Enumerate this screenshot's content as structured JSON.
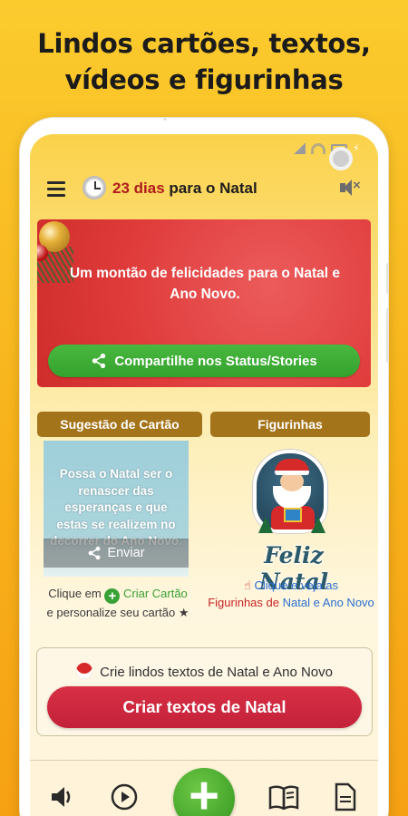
{
  "promo": {
    "headline_line1": "Lindos cartões, textos,",
    "headline_line2": "vídeos e figurinhas"
  },
  "toolbar": {
    "days_count": "23 dias",
    "title_suffix": "para o Natal"
  },
  "hero": {
    "message": "Um montão de felicidades para o Natal e Ano Novo.",
    "share_label": "Compartilhe nos Status/Stories"
  },
  "card_section": {
    "tab_label": "Sugestão de Cartão",
    "preview_text": "Possa o Natal ser o renascer das esperanças e que estas se realizem no decorrer do Ano Novo.",
    "send_label": "Enviar",
    "hint_prefix": "Clique em",
    "hint_action": "Criar Cartão",
    "hint_suffix": "e personalize seu cartão"
  },
  "sticker_section": {
    "tab_label": "Figurinhas",
    "sticker_caption": "Feliz Natal",
    "hint_part1": "Clique e veja as",
    "hint_part2": "Figurinhas de",
    "hint_part3": "Natal e Ano Novo"
  },
  "create_texts": {
    "prompt": "Crie lindos textos de Natal e Ano Novo",
    "button_label": "Criar textos de Natal"
  },
  "colors": {
    "background": "#f9b920",
    "hero_red": "#e03c3c",
    "share_green": "#39a235",
    "tab_brown": "#a4741b",
    "create_red": "#c82339"
  }
}
